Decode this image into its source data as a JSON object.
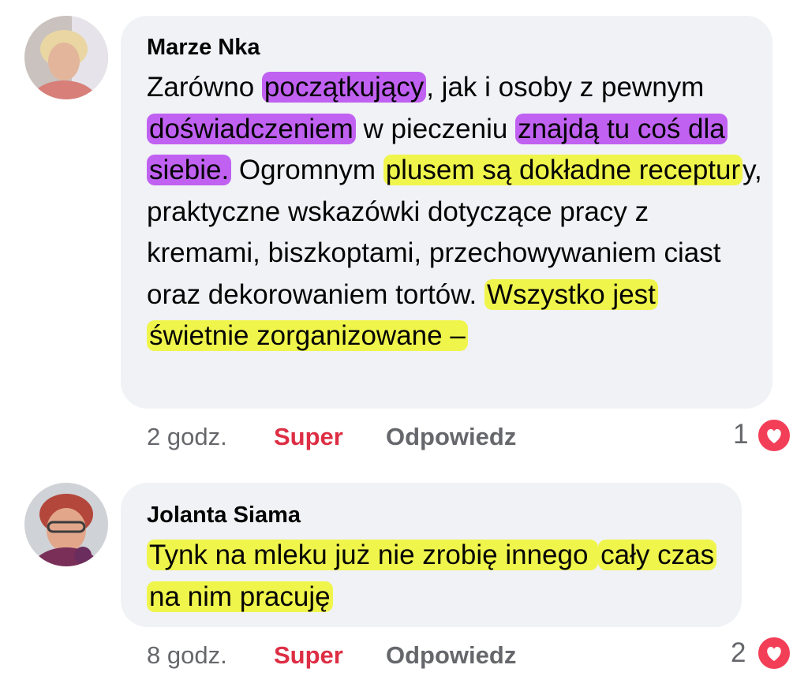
{
  "comments": [
    {
      "author": "Marze Nka",
      "segments": [
        {
          "text": "Zarówno ",
          "hl": ""
        },
        {
          "text": "początkujący",
          "hl": "purple"
        },
        {
          "text": ", jak i osoby z pewnym ",
          "hl": ""
        },
        {
          "text": "doświadczeniem",
          "hl": "purple"
        },
        {
          "text": " w pieczeniu ",
          "hl": ""
        },
        {
          "text": "znajdą tu coś dla siebie.",
          "hl": "purple"
        },
        {
          "text": " Ogromnym ",
          "hl": ""
        },
        {
          "text": "plusem są dokładne receptur",
          "hl": "yellow"
        },
        {
          "text": "y, praktyczne wskazówki dotyczące pracy z kremami, biszkoptami, przechowywaniem ciast oraz dekorowaniem tortów. ",
          "hl": ""
        },
        {
          "text": "Wszystko jest świetnie zorganizowane –",
          "hl": "yellow"
        }
      ],
      "time": "2 godz.",
      "like_label": "Super",
      "reply_label": "Odpowiedz",
      "reaction_count": "1",
      "reaction_icon": "heart-icon"
    },
    {
      "author": "Jolanta Siama",
      "segments": [
        {
          "text": "Tynk na mleku już nie zrobię innego ",
          "hl": "yellow"
        },
        {
          "text": "cały czas na nim pracuję",
          "hl": "yellow"
        }
      ],
      "time": "8 godz.",
      "like_label": "Super",
      "reply_label": "Odpowiedz",
      "reaction_count": "2",
      "reaction_icon": "heart-icon"
    }
  ],
  "colors": {
    "bubble": "#f0f2f5",
    "highlight_purple": "#c061f2",
    "highlight_yellow": "#f0f54c",
    "super": "#dd2e44",
    "heart": "#f33e58"
  }
}
